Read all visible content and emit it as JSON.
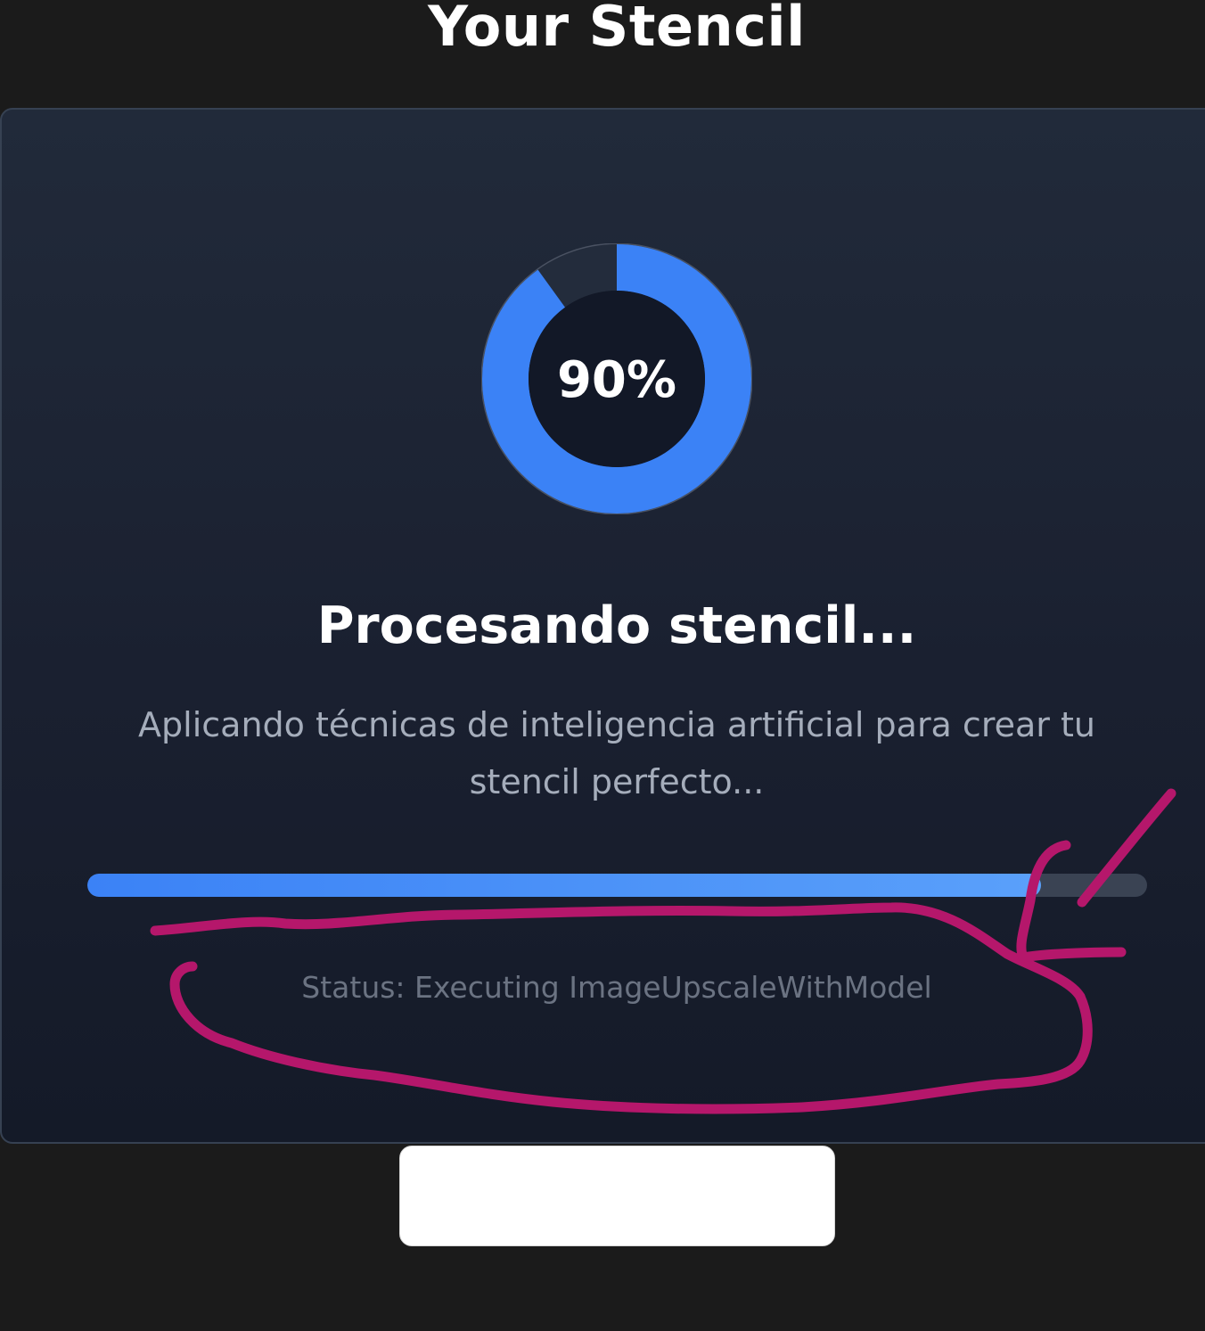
{
  "page": {
    "title": "Your Stencil"
  },
  "progress": {
    "percent_label": "90%",
    "ring_fraction": 0.9,
    "bar_fraction": 0.9
  },
  "processing": {
    "heading": "Procesando stencil...",
    "description": "Aplicando técnicas de inteligencia artificial para crear tu stencil perfecto...",
    "status": "Status: Executing ImageUpscaleWithModel"
  },
  "colors": {
    "accent": "#3b82f6",
    "accent_light": "#5aa0fa",
    "track": "#3a4353",
    "background": "#1b1b1b",
    "card": "#1e2535",
    "annotation_ink": "#b5176b"
  },
  "icons": {
    "progress_ring": "circular-progress-icon"
  }
}
